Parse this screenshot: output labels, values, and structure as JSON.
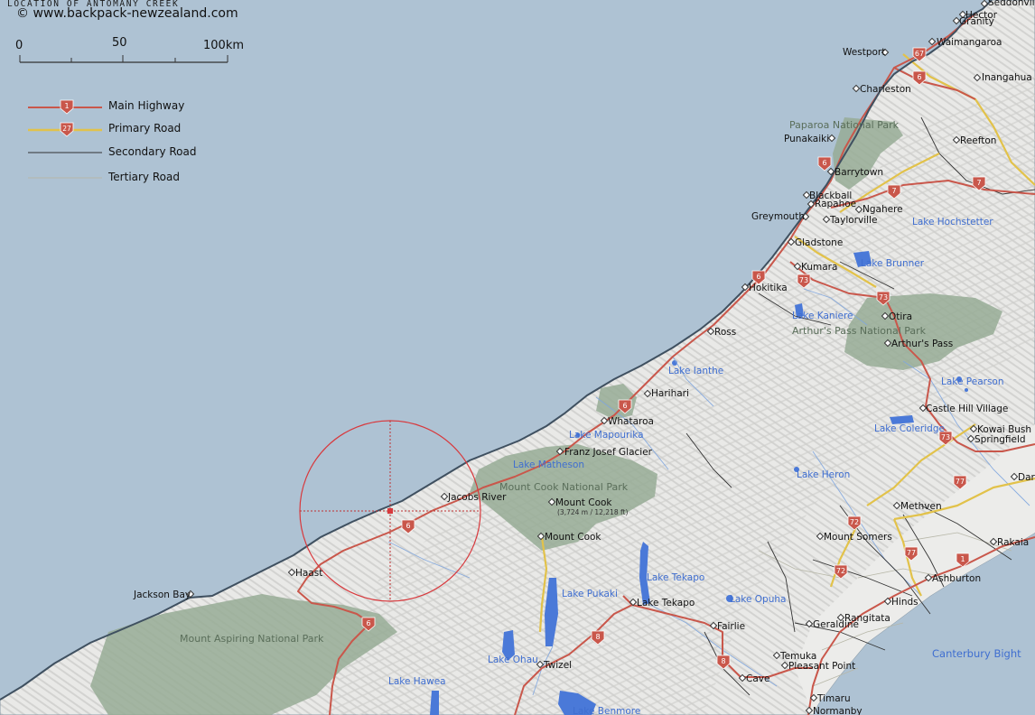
{
  "header": {
    "title": "LOCATION OF ANTOMANY CREEK",
    "site": "© www.backpack-newzealand.com"
  },
  "scale": {
    "labels": [
      "0",
      "50",
      "100km"
    ]
  },
  "legend": [
    {
      "label": "Main Highway",
      "shield": "1",
      "color": "#c9574b"
    },
    {
      "label": "Primary Road",
      "shield": "27",
      "color": "#e2c24a"
    },
    {
      "label": "Secondary Road",
      "color": "#333333"
    },
    {
      "label": "Tertiary Road",
      "color": "#b7b7a8"
    }
  ],
  "colors": {
    "sea": "#aec2d3",
    "land": "#e6e6e4",
    "park": "#96ab95",
    "lake": "#4a79d8",
    "main_highway": "#c9574b",
    "primary_road": "#e2c24a",
    "marker_circle": "#d8383c"
  },
  "places": {
    "seddonville": "Seddonvill",
    "hector": "Hector",
    "granity": "Granity",
    "westport": "Westport",
    "waimangaroa": "Waimangaroa",
    "inangahua": "Inangahua",
    "charleston": "Charleston",
    "paparoa_np": "Paparoa National Park",
    "punakaiki": "Punakaiki",
    "reefton": "Reefton",
    "barrytown": "Barrytown",
    "blackball": "Blackball",
    "rapahoe": "Rapahoe",
    "ngahere": "Ngahere",
    "greymouth": "Greymouth",
    "taylorville": "Taylorville",
    "lake_hochstetter": "Lake Hochstetter",
    "gladstone": "Gladstone",
    "kumara": "Kumara",
    "lake_brunner": "Lake Brunner",
    "hokitika": "Hokitika",
    "lake_kaniere": "Lake Kaniere",
    "otira": "Otira",
    "arthurs_pass_np": "Arthur's Pass National Park",
    "ross": "Ross",
    "arthurs_pass": "Arthur's Pass",
    "lake_ianthe": "Lake Ianthe",
    "lake_pearson": "Lake Pearson",
    "harihari": "Harihari",
    "castle_hill": "Castle Hill Village",
    "whataroa": "Whataroa",
    "lake_coleridge": "Lake Coleridge",
    "kowai_bush": "Kowai Bush",
    "lake_mapourika": "Lake Mapourika",
    "springfield": "Springfield",
    "franz_josef": "Franz Josef Glacier",
    "lake_matheson": "Lake Matheson",
    "darfield": "Dar",
    "lake_heron": "Lake Heron",
    "mount_cook_np": "Mount Cook National Park",
    "jacobs_river": "Jacobs River",
    "mount_cook_peak": "Mount Cook",
    "mount_cook_height": "(3,724 m / 12,218 ft)",
    "methven": "Methven",
    "mount_cook_village": "Mount Cook",
    "mount_somers": "Mount Somers",
    "rakaia": "Rakaia",
    "haast": "Haast",
    "lake_tekapo_lake": "Lake Tekapo",
    "ashburton": "Ashburton",
    "jackson_bay": "Jackson Bay",
    "lake_pukaki": "Lake Pukaki",
    "lake_tekapo_town": "Lake Tekapo",
    "lake_opuha": "Lake Opuha",
    "hinds": "Hinds",
    "rangitata": "Rangitata",
    "fairlie": "Fairlie",
    "geraldine": "Geraldine",
    "mount_aspiring_np": "Mount Aspiring National Park",
    "canterbury_bight": "Canterbury Bight",
    "temuka": "Temuka",
    "lake_ohau": "Lake Ohau",
    "twizel": "Twizel",
    "pleasant_point": "Pleasant Point",
    "lake_hawea": "Lake Hawea",
    "cave": "Cave",
    "timaru": "Timaru",
    "lake_benmore": "Lake Benmore",
    "normanby": "Normanby"
  },
  "shields": {
    "main": [
      "67",
      "6",
      "6",
      "7",
      "6",
      "73",
      "73",
      "6",
      "6",
      "6",
      "1",
      "8",
      "8"
    ],
    "primary": [
      "7",
      "73",
      "77",
      "77",
      "72",
      "72"
    ]
  }
}
